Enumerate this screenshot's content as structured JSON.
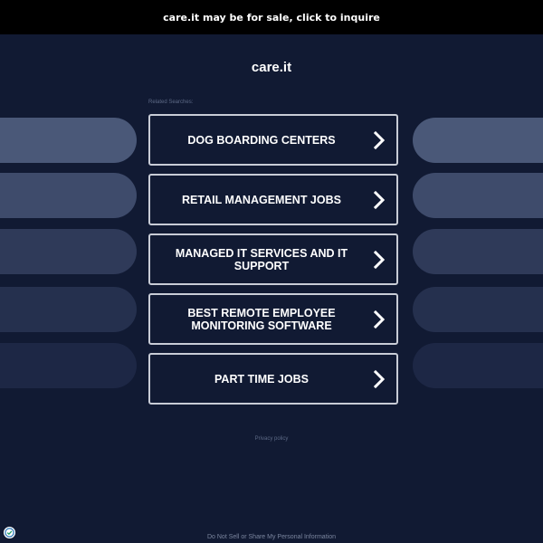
{
  "banner": {
    "text": "care.it may be for sale, click to inquire"
  },
  "header": {
    "domain": "care.it"
  },
  "related": {
    "label": "Related Searches:",
    "items": [
      {
        "label": "DOG BOARDING CENTERS"
      },
      {
        "label": "RETAIL MANAGEMENT JOBS"
      },
      {
        "label": "MANAGED IT SERVICES AND IT SUPPORT"
      },
      {
        "label": "BEST REMOTE EMPLOYEE MONITORING SOFTWARE"
      },
      {
        "label": "PART TIME JOBS"
      }
    ]
  },
  "footer": {
    "privacy": "Privacy policy",
    "do_not_sell": "Do Not Sell or Share My Personal Information"
  },
  "colors": {
    "background": "#111a33",
    "banner": "#000000",
    "card_border": "#c8ccd6",
    "pill_shades": [
      "#4a5878",
      "#3e4b6b",
      "#2f3a59",
      "#25304e",
      "#1d2745"
    ]
  },
  "icons": {
    "chevron": "chevron-right-icon",
    "consent": "privacy-consent-icon"
  }
}
